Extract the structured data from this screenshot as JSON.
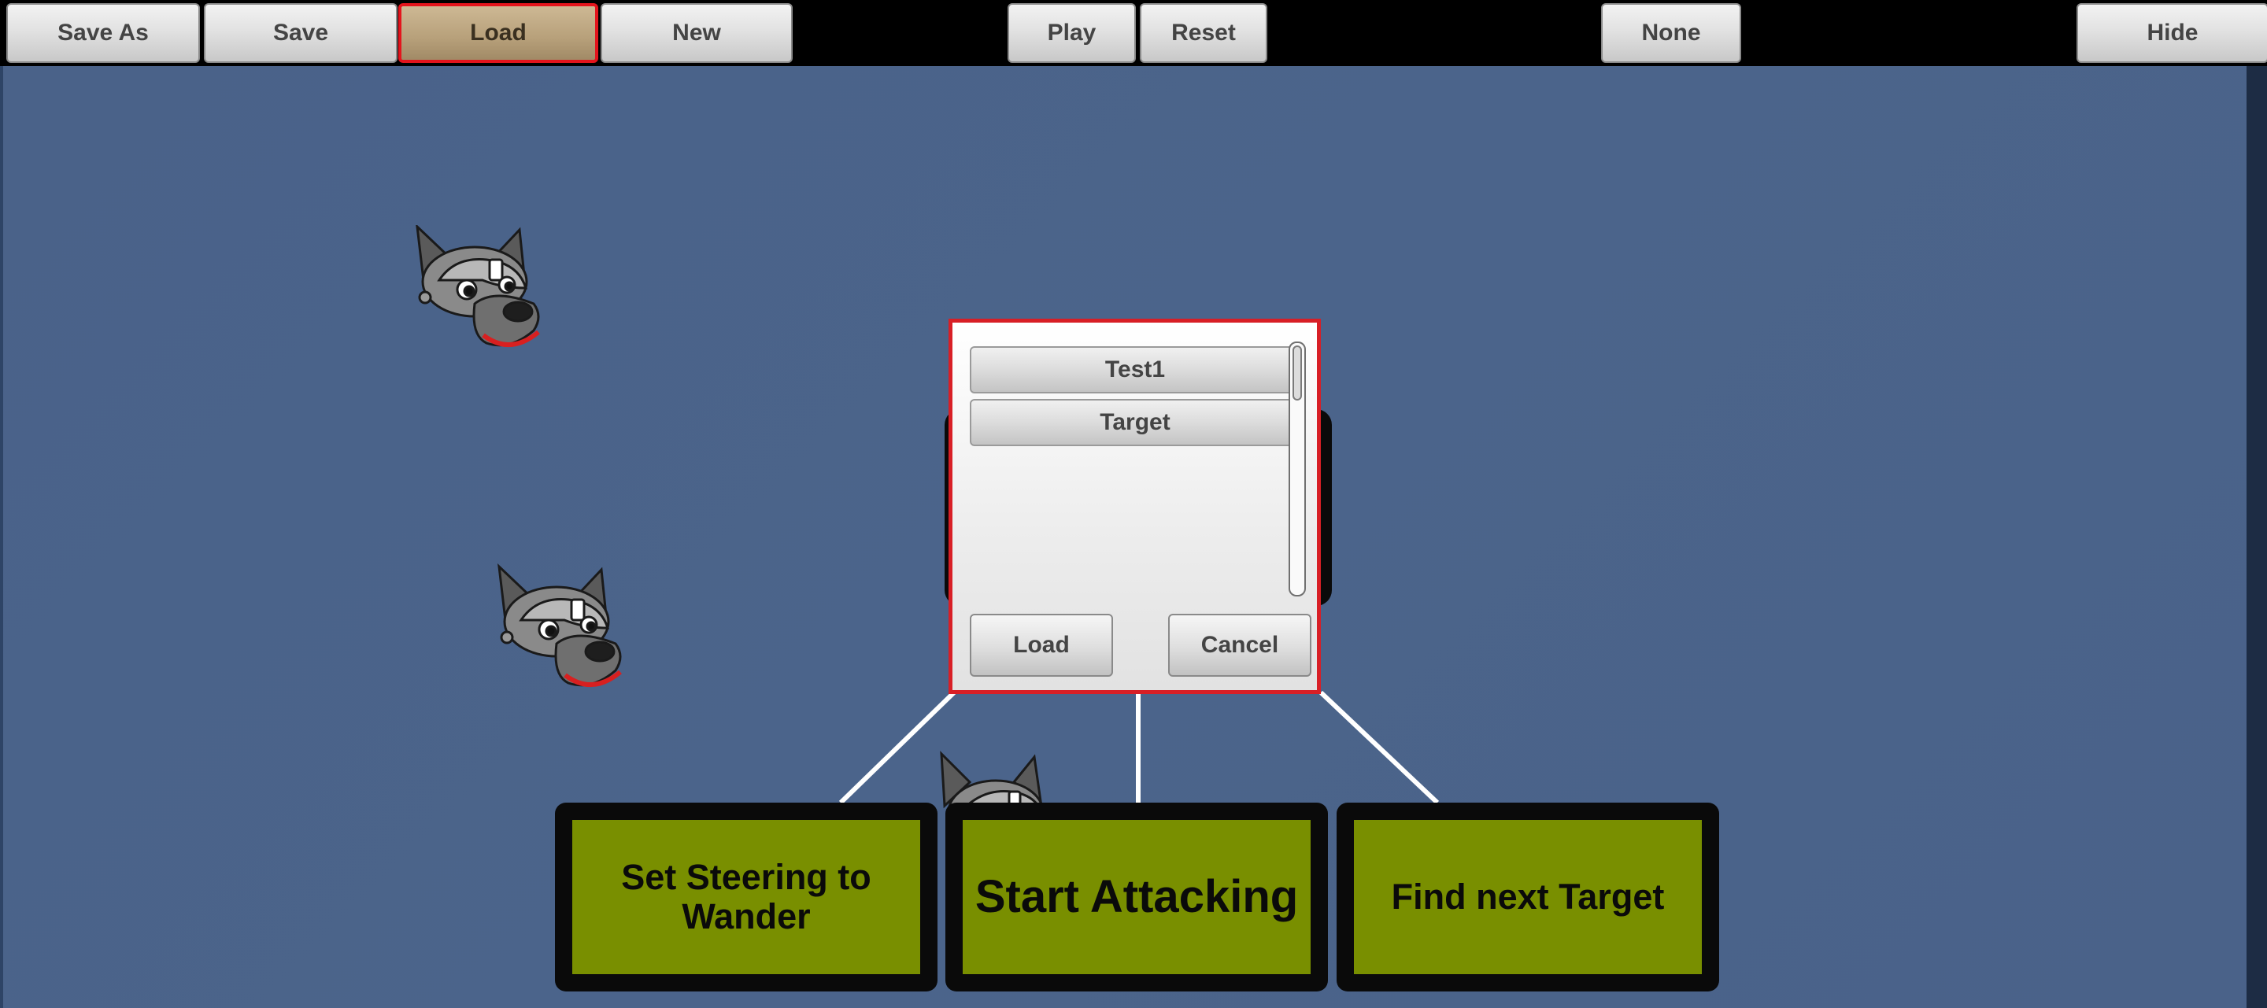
{
  "toolbar": {
    "save_as": "Save As",
    "save": "Save",
    "load": "Load",
    "new": "New",
    "play": "Play",
    "reset": "Reset",
    "none": "None",
    "hide": "Hide"
  },
  "dialog": {
    "items": [
      "Test1",
      "Target"
    ],
    "load_label": "Load",
    "cancel_label": "Cancel"
  },
  "nodes": {
    "wander": "Set Steering to Wander",
    "attack": "Start Attacking",
    "find_target": "Find next Target"
  },
  "colors": {
    "canvas": "#4a6289",
    "node_fill": "#798f00",
    "highlight_border": "#d81f26",
    "active_button": "#b7a07a"
  },
  "icons": [
    "wolf-head-icon"
  ]
}
